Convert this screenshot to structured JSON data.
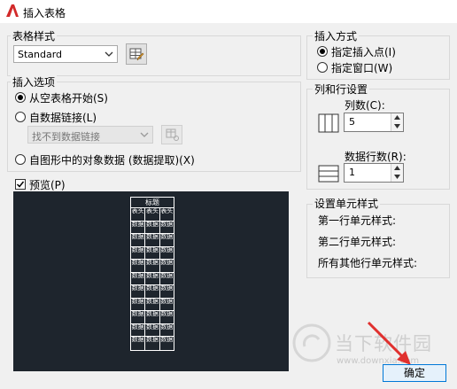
{
  "window": {
    "title": "插入表格"
  },
  "table_style": {
    "group_label": "表格样式",
    "selected": "Standard"
  },
  "insert_options": {
    "group_label": "插入选项",
    "from_empty": "从空表格开始(S)",
    "from_data_link": "自数据链接(L)",
    "data_link_placeholder": "找不到数据链接",
    "from_objects": "自图形中的对象数据 (数据提取)(X)"
  },
  "preview": {
    "label": "预览(P)",
    "table_title": "标题",
    "header_cells": [
      "表头",
      "表头",
      "表头"
    ],
    "data_cell": "数据",
    "row_count": 11
  },
  "insert_method": {
    "group_label": "插入方式",
    "point": "指定插入点(I)",
    "window": "指定窗口(W)"
  },
  "column_row": {
    "group_label": "列和行设置",
    "columns_label": "列数(C):",
    "columns_value": "5",
    "rows_label": "数据行数(R):",
    "rows_value": "1"
  },
  "cell_styles": {
    "group_label": "设置单元样式",
    "first_row": "第一行单元样式:",
    "second_row": "第二行单元样式:",
    "other_rows": "所有其他行单元样式:"
  },
  "buttons": {
    "ok": "确定"
  },
  "watermark": {
    "text": "当下软件园",
    "url": "www.downxia.com"
  },
  "colors": {
    "accent": "#0078d7",
    "preview_bg": "#1e252d",
    "arrow": "#e0302e"
  }
}
